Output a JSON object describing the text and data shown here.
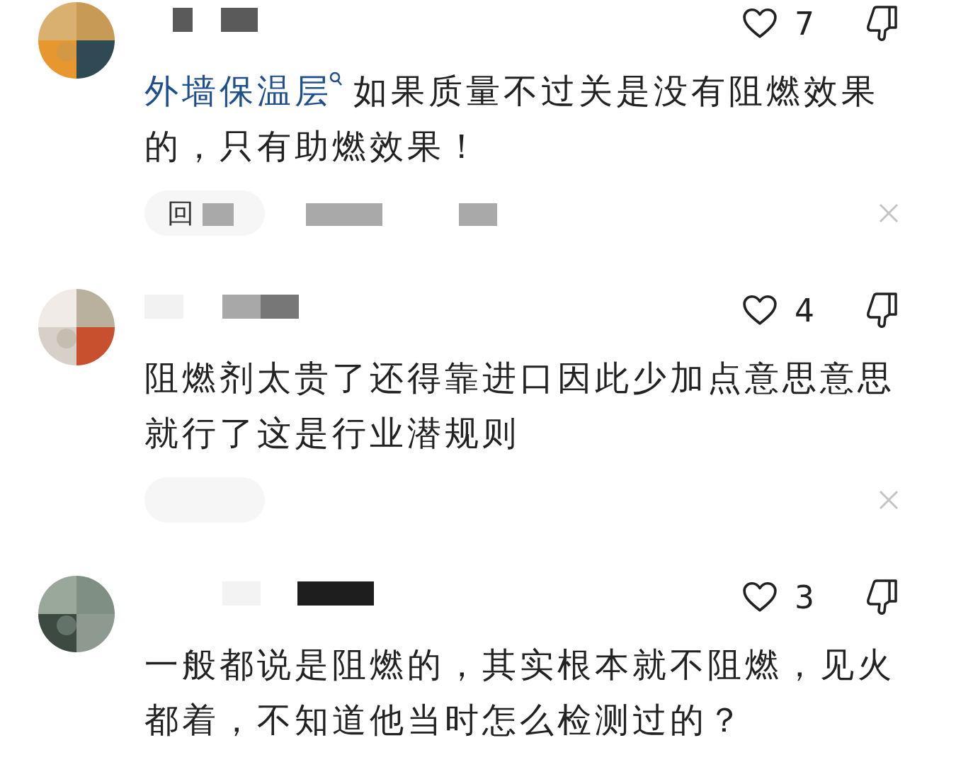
{
  "comments": [
    {
      "likes": "7",
      "body_link": "外墙保温层",
      "body": "如果质量不过关是没有阻燃效果的，只有助燃效果！",
      "reply_text": "回",
      "reply_bar": true
    },
    {
      "likes": "4",
      "body": "阻燃剂太贵了还得靠进口因此少加点意思意思就行了这是行业潜规则",
      "reply_bar": true
    },
    {
      "likes": "3",
      "body": "一般都说是阻燃的，其实根本就不阻燃，见火都着，不知道他当时怎么检测过的？",
      "reply_bar": false
    }
  ]
}
